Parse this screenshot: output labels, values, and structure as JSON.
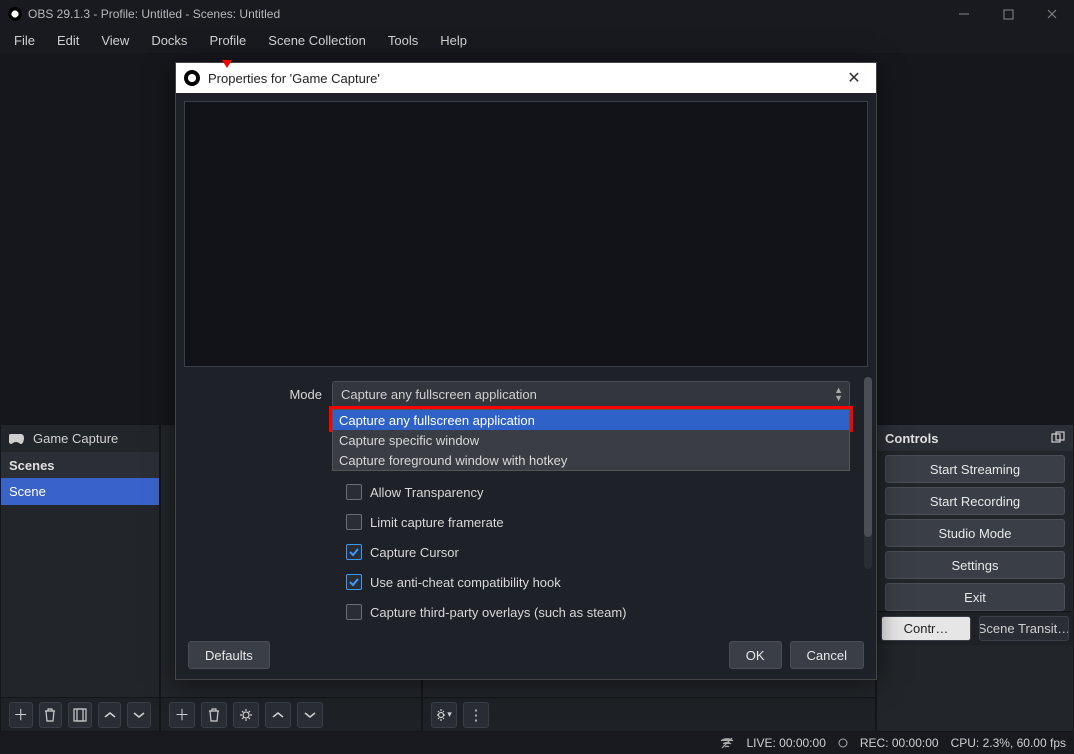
{
  "title": "OBS 29.1.3 - Profile: Untitled - Scenes: Untitled",
  "menu": {
    "file": "File",
    "edit": "Edit",
    "view": "View",
    "docks": "Docks",
    "profile": "Profile",
    "scenecol": "Scene Collection",
    "tools": "Tools",
    "help": "Help"
  },
  "sources_item": "Game Capture",
  "scenes_head": "Scenes",
  "scene_item": "Scene",
  "controls_head": "Controls",
  "ctrl": {
    "stream": "Start Streaming",
    "record": "Start Recording",
    "studio": "Studio Mode",
    "settings": "Settings",
    "exit": "Exit"
  },
  "tabs": {
    "controls": "Contr…",
    "trans": "Scene Transit…"
  },
  "dlg": {
    "title": "Properties for 'Game Capture'",
    "mode_lbl": "Mode",
    "mode_val": "Capture any fullscreen application",
    "opts": {
      "fullscreen": "Capture any fullscreen application",
      "window": "Capture specific window",
      "hotkey": "Capture foreground window with hotkey"
    },
    "chk": {
      "transparency": "Allow Transparency",
      "framerate": "Limit capture framerate",
      "cursor": "Capture Cursor",
      "anticheat": "Use anti-cheat compatibility hook",
      "overlays": "Capture third-party overlays (such as steam)"
    },
    "defaults": "Defaults",
    "ok": "OK",
    "cancel": "Cancel"
  },
  "status": {
    "live": "LIVE: 00:00:00",
    "rec": "REC: 00:00:00",
    "cpu": "CPU: 2.3%, 60.00 fps"
  }
}
